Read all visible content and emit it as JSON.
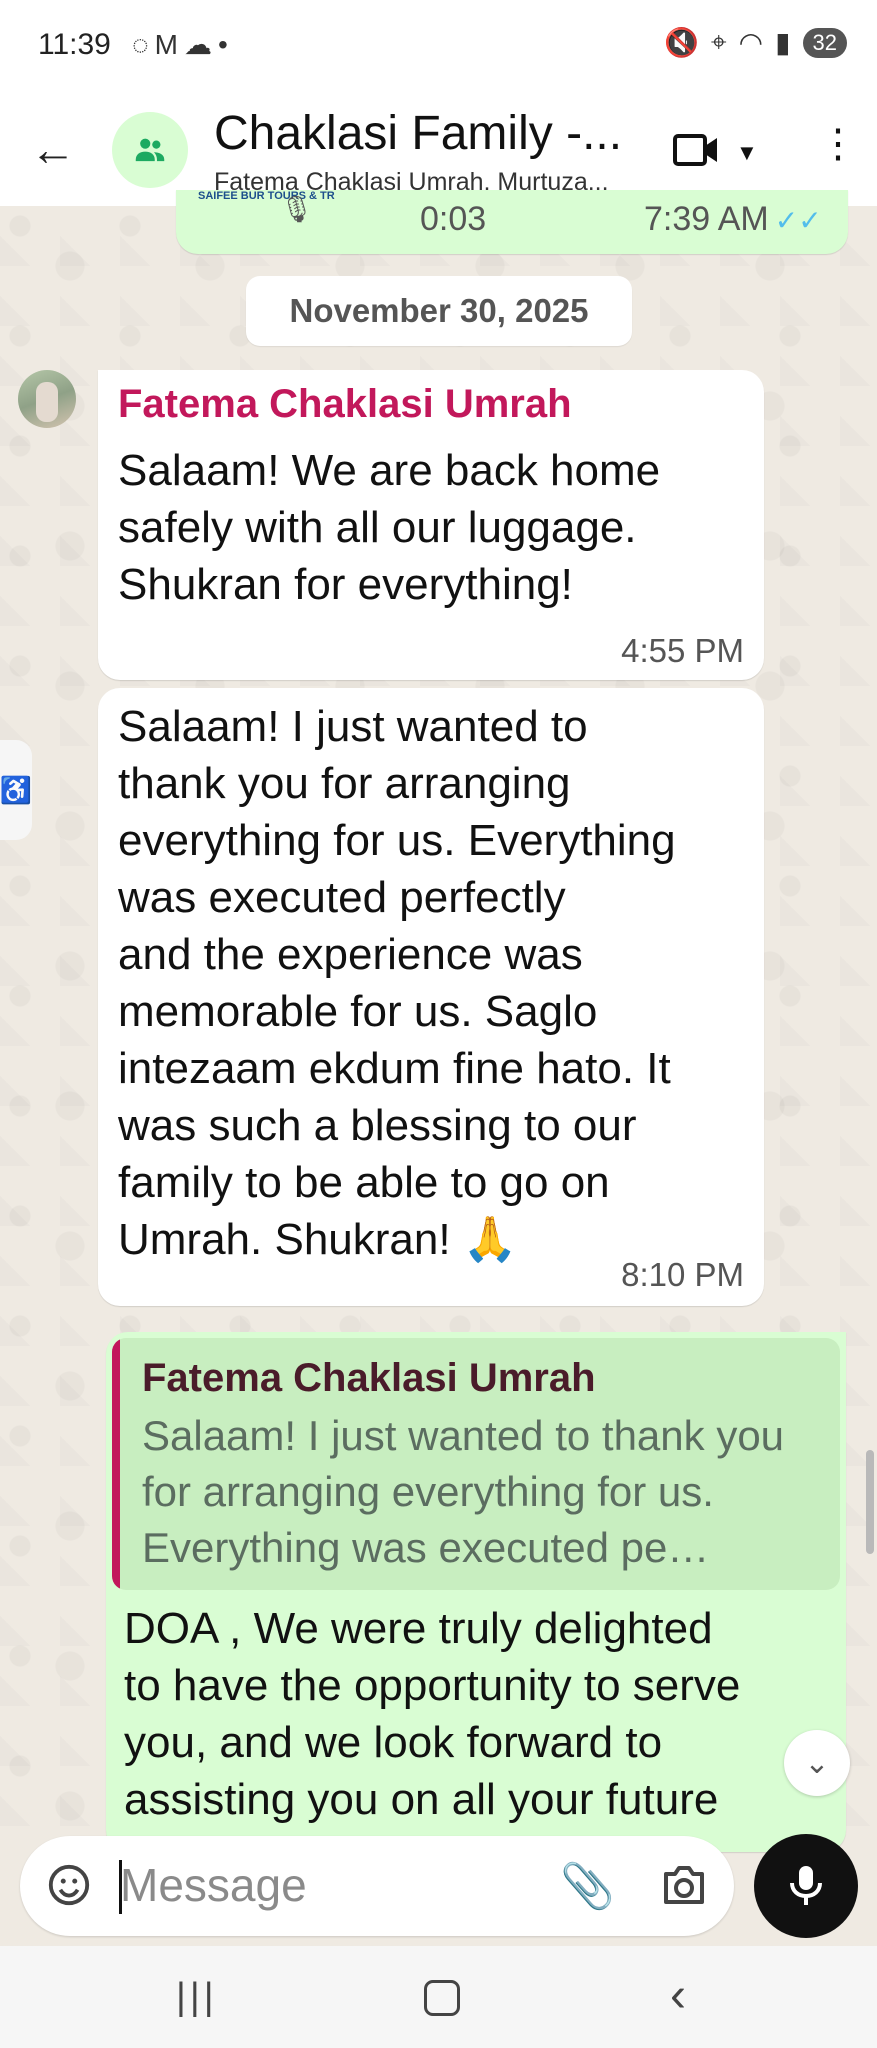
{
  "status_bar": {
    "time": "11:39",
    "battery": "32"
  },
  "header": {
    "title": "Chaklasi Family -...",
    "subtitle": "Fatema Chaklasi Umrah, Murtuza..."
  },
  "voice_message": {
    "thumbnail_label": "SAIFEE BUR TOURS & TR",
    "duration": "0:03",
    "time": "7:39 AM"
  },
  "date_separator": "November 30, 2025",
  "messages": [
    {
      "sender": "Fatema Chaklasi Umrah",
      "text": "Salaam! We are back home\nsafely with all our luggage.\nShukran for everything!",
      "time": "4:55 PM"
    },
    {
      "text": "Salaam! I just wanted to\nthank you for arranging\neverything for us. Everything\nwas executed perfectly\nand the experience was\nmemorable for us. Saglo\nintezaam ekdum fine hato. It\nwas such a blessing to our\nfamily to be able to go on\nUmrah. Shukran! 🙏",
      "time": "8:10 PM"
    }
  ],
  "reply": {
    "quoted_sender": "Fatema Chaklasi Umrah",
    "quoted_text": "Salaam! I just wanted to thank you for arranging everything for us. Everything was executed pe…",
    "text": "DOA , We were truly delighted\nto have the opportunity to serve\nyou, and we look forward to\nassisting you on all your future"
  },
  "composer": {
    "placeholder": "Message"
  },
  "colors": {
    "sender_name": "#c2185b",
    "outgoing_bubble": "#d9fdd3",
    "read_ticks": "#53bdeb",
    "chat_background": "#efeae2"
  }
}
